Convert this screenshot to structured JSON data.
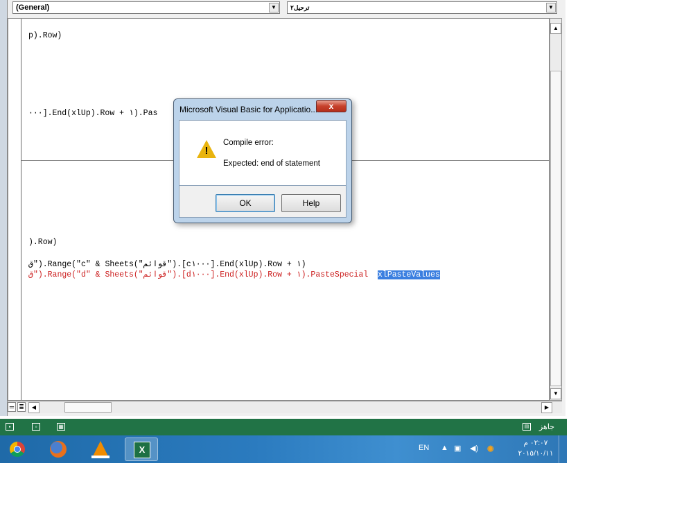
{
  "window": {
    "object_combo": "(General)",
    "procedure_combo": "ترحيل٢"
  },
  "code_lines": [
    {
      "text": "p).Row)",
      "style": "normal"
    },
    {
      "text": "···].End(xlUp).Row + ١).Pas",
      "style": "normal"
    },
    {
      "text": ").Row)",
      "style": "normal"
    },
    {
      "text": "ق\").Range(\"c\" & Sheets(\"قوائم\").[c١···].End(xlUp).Row + ١)",
      "style": "normal"
    },
    {
      "text_before_selection": "ق\").Range(\"d\" & Sheets(\"قوائم\").[d١···].End(xlUp).Row + ١).PasteSpecial  ",
      "selected_text": "xlPasteValues",
      "style": "error"
    }
  ],
  "dialog": {
    "title": "Microsoft Visual Basic for Applicatio...",
    "close_label": "x",
    "icon": "warning-icon",
    "message_title": "Compile error:",
    "message_detail": "Expected: end of statement",
    "ok_label": "OK",
    "help_label": "Help"
  },
  "status_bar": {
    "ready_text": "جاهز",
    "view_icons": [
      "normal-view-icon",
      "page-layout-icon",
      "page-break-icon"
    ]
  },
  "taskbar": {
    "apps": [
      "chrome-icon",
      "firefox-icon",
      "vlc-icon",
      "excel-icon"
    ],
    "active_app": "excel-icon",
    "language": "EN",
    "time": "٠٢:٠٧ م",
    "date": "٢٠١٥/١٠/١١"
  },
  "colors": {
    "error_text": "#cc1f1f",
    "selection": "#3b7fe0",
    "excel_status": "#217346",
    "dialog_frame": "#bcd3ea"
  }
}
